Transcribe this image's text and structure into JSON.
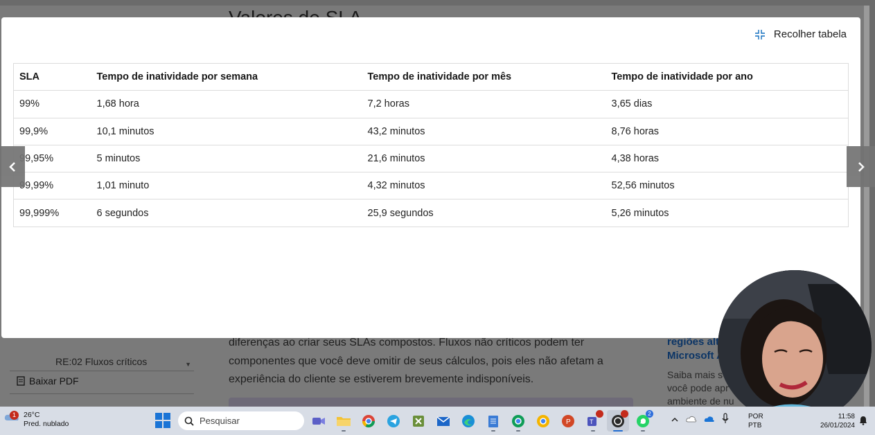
{
  "background_page": {
    "title": "Valores de SLA",
    "sidebar_item": "RE:02 Fluxos críticos",
    "download_pdf": "Baixar PDF",
    "body_lines": [
      "diferenças ao criar seus SLAs compostos. Fluxos não críticos podem ter",
      "componentes que você deve omitir de seus cálculos, pois eles não afetam a",
      "experiência do cliente se estiverem brevemente indisponíveis."
    ],
    "right_link_lines": [
      "regiões alta",
      "Microsoft A"
    ],
    "right_text_lines": [
      "Saiba mais s",
      "você pode apr",
      "ambiente de nu"
    ]
  },
  "modal": {
    "collapse_label": "Recolher tabela",
    "table": {
      "headers": [
        "SLA",
        "Tempo de inatividade por semana",
        "Tempo de inatividade por mês",
        "Tempo de inatividade por ano"
      ],
      "rows": [
        [
          "99%",
          "1,68 hora",
          "7,2 horas",
          "3,65 dias"
        ],
        [
          "99,9%",
          "10,1 minutos",
          "43,2 minutos",
          "8,76 horas"
        ],
        [
          "99,95%",
          "5 minutos",
          "21,6 minutos",
          "4,38 horas"
        ],
        [
          "99,99%",
          "1,01 minuto",
          "4,32 minutos",
          "52,56 minutos"
        ],
        [
          "99,999%",
          "6 segundos",
          "25,9 segundos",
          "5,26 minutos"
        ]
      ]
    }
  },
  "taskbar": {
    "weather_temp": "26°C",
    "weather_desc": "Pred. nublado",
    "weather_badge": "1",
    "search_placeholder": "Pesquisar",
    "whatsapp_badge": "2",
    "lang_line1": "POR",
    "lang_line2": "PTB",
    "time": "11:58",
    "date": "26/01/2024",
    "apps": [
      "teams-meet",
      "file-explorer",
      "chrome",
      "telegram",
      "excel-like",
      "mail",
      "edge",
      "notepad",
      "chrome-profile-1",
      "chrome-profile-2",
      "powerpoint",
      "teams",
      "obs",
      "whatsapp"
    ]
  },
  "colors": {
    "overlay_gray": "#7a7a7a",
    "modal_bg": "#ffffff",
    "taskbar_bg": "#d8dde6",
    "link_blue": "#0c3566"
  }
}
